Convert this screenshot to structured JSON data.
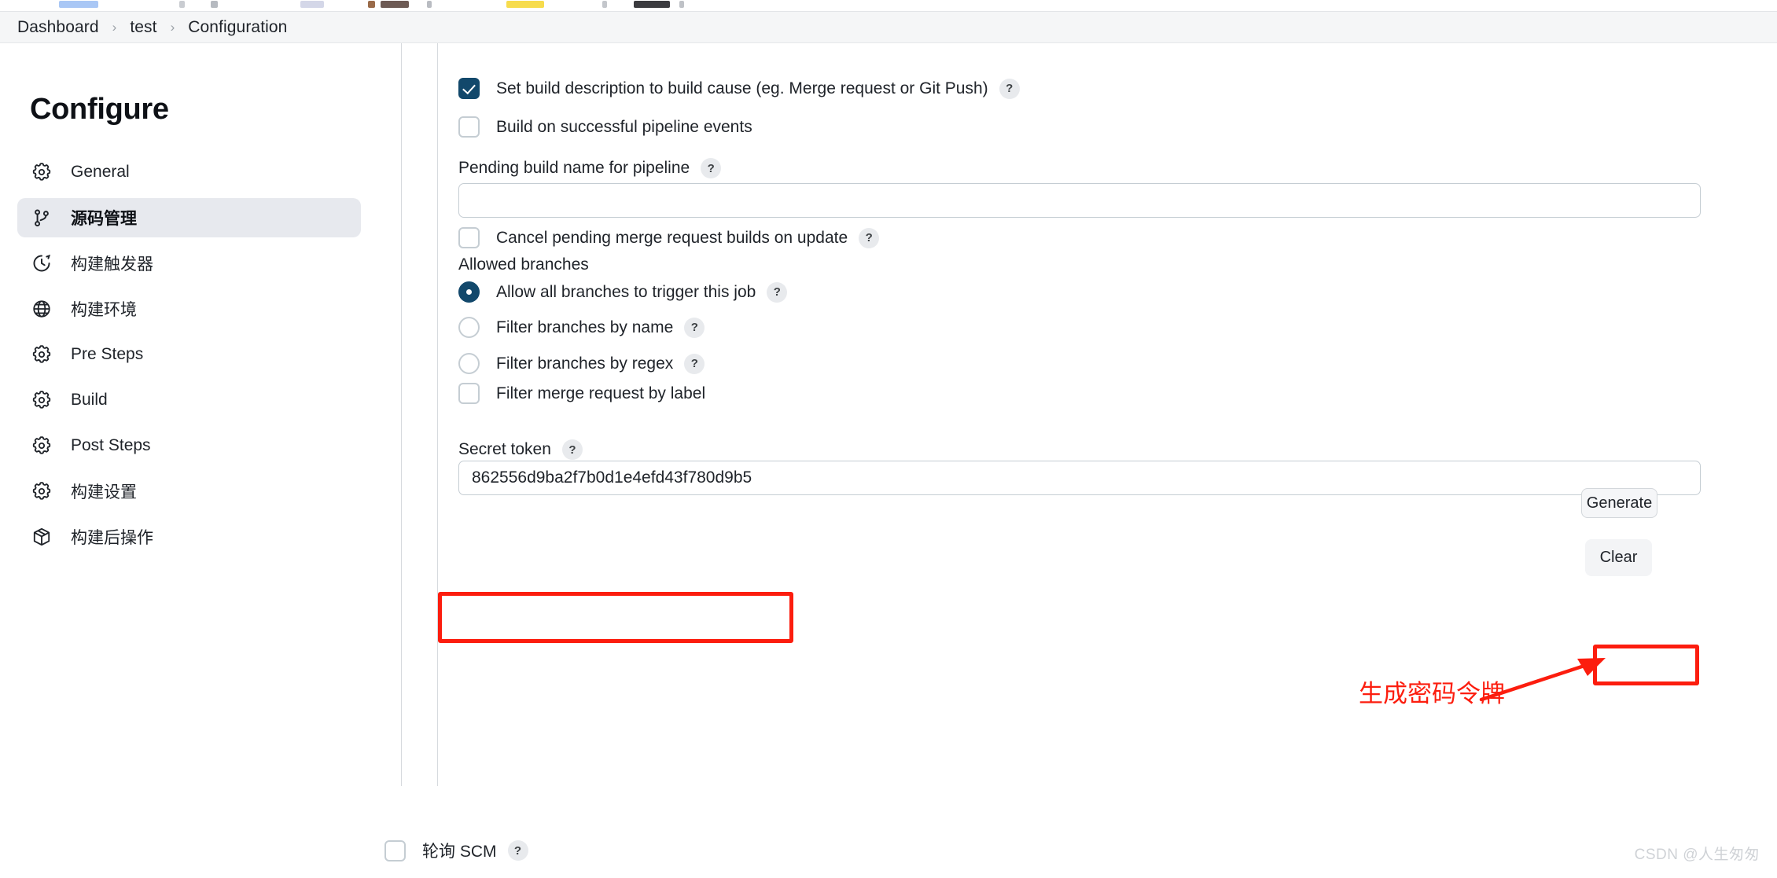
{
  "breadcrumb": {
    "items": [
      "Dashboard",
      "test",
      "Configuration"
    ],
    "separator": "›"
  },
  "sidebar": {
    "title": "Configure",
    "items": [
      {
        "label": "General",
        "icon": "gear-icon",
        "active": false
      },
      {
        "label": "源码管理",
        "icon": "git-branch-icon",
        "active": true
      },
      {
        "label": "构建触发器",
        "icon": "clock-icon",
        "active": false
      },
      {
        "label": "构建环境",
        "icon": "globe-icon",
        "active": false
      },
      {
        "label": "Pre Steps",
        "icon": "gear-icon",
        "active": false
      },
      {
        "label": "Build",
        "icon": "gear-icon",
        "active": false
      },
      {
        "label": "Post Steps",
        "icon": "gear-icon",
        "active": false
      },
      {
        "label": "构建设置",
        "icon": "gear-icon",
        "active": false
      },
      {
        "label": "构建后操作",
        "icon": "package-icon",
        "active": false
      }
    ]
  },
  "form": {
    "help_glyph": "?",
    "set_build_description": {
      "label": "Set build description to build cause (eg. Merge request or Git Push)",
      "checked": true,
      "has_help": true
    },
    "build_on_pipeline": {
      "label": "Build on successful pipeline events",
      "checked": false,
      "has_help": false
    },
    "pending_build_name": {
      "label": "Pending build name for pipeline",
      "value": "",
      "placeholder": "",
      "has_help": true
    },
    "cancel_pending": {
      "label": "Cancel pending merge request builds on update",
      "checked": false,
      "has_help": true
    },
    "allowed_branches_label": "Allowed branches",
    "branch_options": [
      {
        "label": "Allow all branches to trigger this job",
        "type": "radio",
        "selected": true,
        "has_help": true
      },
      {
        "label": "Filter branches by name",
        "type": "radio",
        "selected": false,
        "has_help": true
      },
      {
        "label": "Filter branches by regex",
        "type": "radio",
        "selected": false,
        "has_help": true
      },
      {
        "label": "Filter merge request by label",
        "type": "checkbox",
        "selected": false,
        "has_help": false
      }
    ],
    "secret_token": {
      "label": "Secret token",
      "value": "862556d9ba2f7b0d1e4efd43f780d9b5",
      "placeholder": "",
      "has_help": true
    },
    "generate_button": "Generate",
    "clear_button": "Clear",
    "poll_scm": {
      "label": "轮询 SCM",
      "checked": false,
      "has_help": true
    }
  },
  "annotation": {
    "text": "生成密码令牌",
    "color": "#fc1d0e"
  },
  "watermark": "CSDN @人生匆匆",
  "colors": {
    "accent": "#12486b",
    "breadcrumb_bg": "#f5f6f7",
    "nav_active_bg": "#e7e9ee",
    "annotation_red": "#fc1d0e",
    "border": "#c5cdd3"
  }
}
